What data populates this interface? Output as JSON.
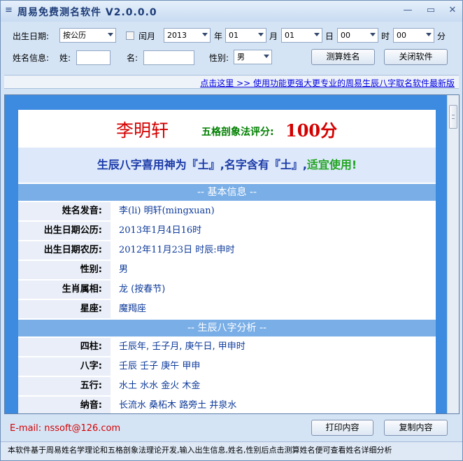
{
  "window": {
    "title": "周易免费测名软件 V2.0.0.0",
    "minimize": "—",
    "maximize": "▭",
    "close": "✕"
  },
  "form": {
    "birth_date_label": "出生日期:",
    "calendar_type": "按公历",
    "leap_month_label": "闰月",
    "year": "2013",
    "year_unit": "年",
    "month": "01",
    "month_unit": "月",
    "day": "01",
    "day_unit": "日",
    "hour": "00",
    "hour_unit": "时",
    "minute": "00",
    "minute_unit": "分",
    "name_info_label": "姓名信息:",
    "surname_label": "姓:",
    "surname_value": "",
    "given_label": "名:",
    "given_value": "",
    "gender_label": "性别:",
    "gender_value": "男",
    "compute_button": "测算姓名",
    "close_button": "关闭软件"
  },
  "promo_link": "点击这里 >> 使用功能更强大更专业的周易生辰八字取名软件最新版",
  "result": {
    "name": "李明轩",
    "score_label": "五格剖象法评分:",
    "score_value": "100分",
    "verdict_prefix": "生辰八字喜用神为『土』,名字含有『土』,",
    "verdict_suffix": "适宜使用!",
    "basic_section": "-- 基本信息 --",
    "basic_rows": [
      {
        "key": "姓名发音:",
        "value": "李(li) 明轩(mingxuan)"
      },
      {
        "key": "出生日期公历:",
        "value": "2013年1月4日16时"
      },
      {
        "key": "出生日期农历:",
        "value": "2012年11月23日 时辰:申时"
      },
      {
        "key": "性别:",
        "value": "男"
      },
      {
        "key": "生肖属相:",
        "value": "龙 (按春节)"
      },
      {
        "key": "星座:",
        "value": "魔羯座"
      }
    ],
    "bazi_section": "-- 生辰八字分析 --",
    "bazi_rows": [
      {
        "key": "四柱:",
        "value": "壬辰年, 壬子月, 庚午日, 甲申时"
      },
      {
        "key": "八字:",
        "value": "壬辰 壬子 庚午 甲申"
      },
      {
        "key": "五行:",
        "value": "水土 水水 金火 木金"
      },
      {
        "key": "纳音:",
        "value": "长流水 桑柘木 路旁土 井泉水"
      }
    ]
  },
  "footer": {
    "email": "E-mail: nssoft@126.com",
    "print_button": "打印内容",
    "copy_button": "复制内容",
    "status_text": "本软件基于周易姓名学理论和五格剖象法理论开发,输入出生信息,姓名,性别后点击测算姓名便可查看姓名详细分析"
  }
}
